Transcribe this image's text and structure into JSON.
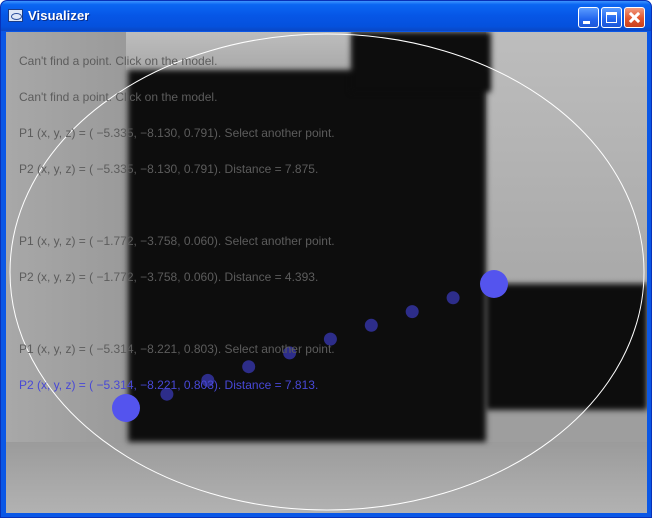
{
  "window": {
    "title": "Visualizer",
    "app_icon": "visualizer-app-icon",
    "controls": {
      "minimize_icon": "minimize-icon",
      "maximize_icon": "maximize-icon",
      "close_icon": "close-icon"
    }
  },
  "log": [
    {
      "text": "Can't find a point. Click on the model.",
      "active": false
    },
    {
      "text": "Can't find a point. Click on the model.",
      "active": false
    },
    {
      "text": "P1 (x, y, z) = ( −5.335, −8.130, 0.791). Select another point.",
      "active": false
    },
    {
      "text": "P2 (x, y, z) = ( −5.335, −8.130, 0.791).  Distance = 7.875.",
      "active": false
    },
    {
      "text": "P1 (x, y, z) = ( −1.772, −3.758, 0.060). Select another point.",
      "active": false
    },
    {
      "text": "P2 (x, y, z) = ( −1.772, −3.758, 0.060).  Distance = 4.393.",
      "active": false
    },
    {
      "text": "P1 (x, y, z) = ( −5.314, −8.221, 0.803). Select another point.",
      "active": false
    },
    {
      "text": "P2 (x, y, z) = ( −5.314, −8.221, 0.803).  Distance = 7.813.",
      "active": true
    }
  ],
  "measurement": {
    "intermediate_marker_count": 8,
    "colors": {
      "endpoint": "#5454ee",
      "path_dot": "#2d2d8a",
      "boundary_ellipse": "#ffffff",
      "active_text": "#4848d6",
      "inactive_text": "#5c5c5c"
    }
  }
}
